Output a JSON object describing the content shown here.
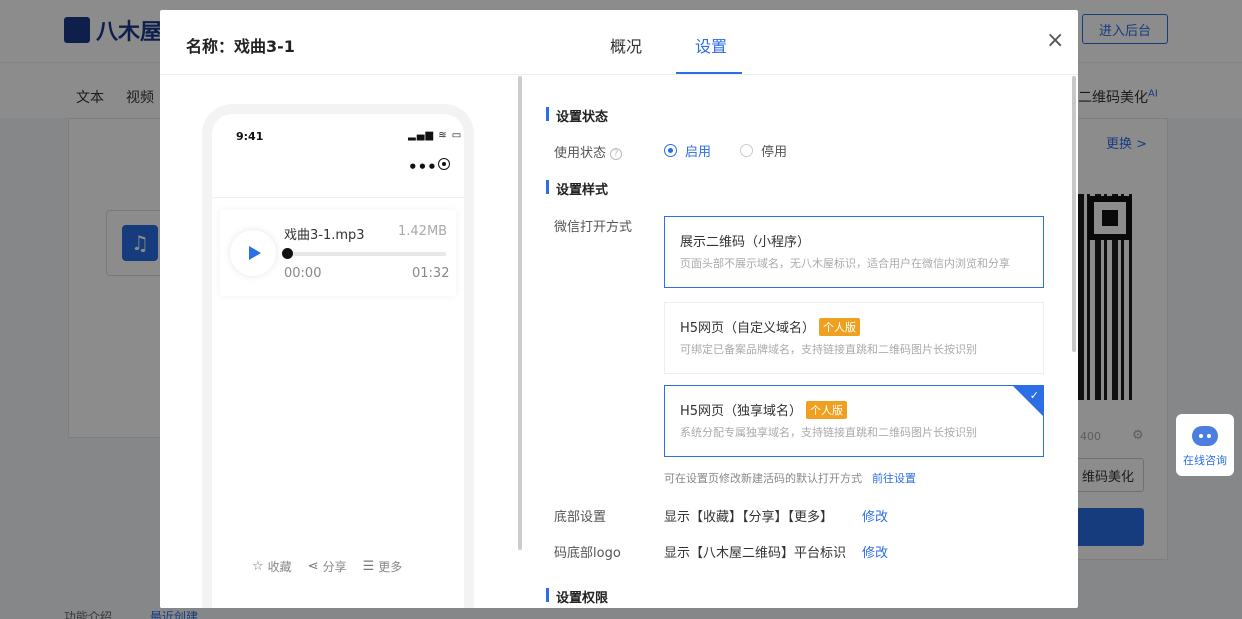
{
  "background": {
    "logo_text": "八木屋",
    "enter_backend": "进入后台",
    "nav_items": [
      "文本",
      "视频"
    ],
    "nav_ai": "二维码美化",
    "nav_ai_sup": "AI",
    "replace": "更换 >",
    "size_text": "400",
    "beautify": "维码美化",
    "online_consult": "在线咨询",
    "bottom_left": "功能介绍",
    "bottom_right": "最近创建"
  },
  "modal": {
    "title": "名称：戏曲3-1",
    "tabs": [
      {
        "label": "概况",
        "active": false
      },
      {
        "label": "设置",
        "active": true
      }
    ],
    "close": "×"
  },
  "phone": {
    "time": "9:41",
    "status_icons": "▂▄▆ ≋ ▭",
    "menu_dots": "•••",
    "audio": {
      "name": "戏曲3-1.mp3",
      "size": "1.42MB",
      "current": "00:00",
      "duration": "01:32",
      "progress": 0
    },
    "actions": [
      {
        "icon": "☆",
        "label": "收藏"
      },
      {
        "icon": "⋖",
        "label": "分享"
      },
      {
        "icon": "☰",
        "label": "更多"
      }
    ]
  },
  "settings": {
    "status_section": "设置状态",
    "usage_label": "使用状态",
    "usage_help": "?",
    "status_options": [
      {
        "label": "启用",
        "selected": true
      },
      {
        "label": "停用",
        "selected": false
      }
    ],
    "style_section": "设置样式",
    "wechat_label": "微信打开方式",
    "open_options": [
      {
        "title": "展示二维码（小程序）",
        "badge": "",
        "desc": "页面头部不展示域名，无八木屋标识，适合用户在微信内浏览和分享",
        "selected": false,
        "highlight": true
      },
      {
        "title": "H5网页（自定义域名）",
        "badge": "个人版",
        "desc": "可绑定已备案品牌域名，支持链接直跳和二维码图片长按识别",
        "selected": false,
        "highlight": false
      },
      {
        "title": "H5网页（独享域名）",
        "badge": "个人版",
        "desc": "系统分配专属独享域名，支持链接直跳和二维码图片长按识别",
        "selected": true,
        "highlight": false
      }
    ],
    "hint": "可在设置页修改新建活码的默认打开方式",
    "hint_link": "前往设置",
    "bottom_label": "底部设置",
    "bottom_value": "显示【收藏】【分享】【更多】",
    "bottom_edit": "修改",
    "logo_label": "码底部logo",
    "logo_value": "显示【八木屋二维码】平台标识",
    "logo_edit": "修改",
    "permission_section": "设置权限"
  },
  "colors": {
    "accent": "#2b6ee6",
    "badge": "#f0a020"
  }
}
